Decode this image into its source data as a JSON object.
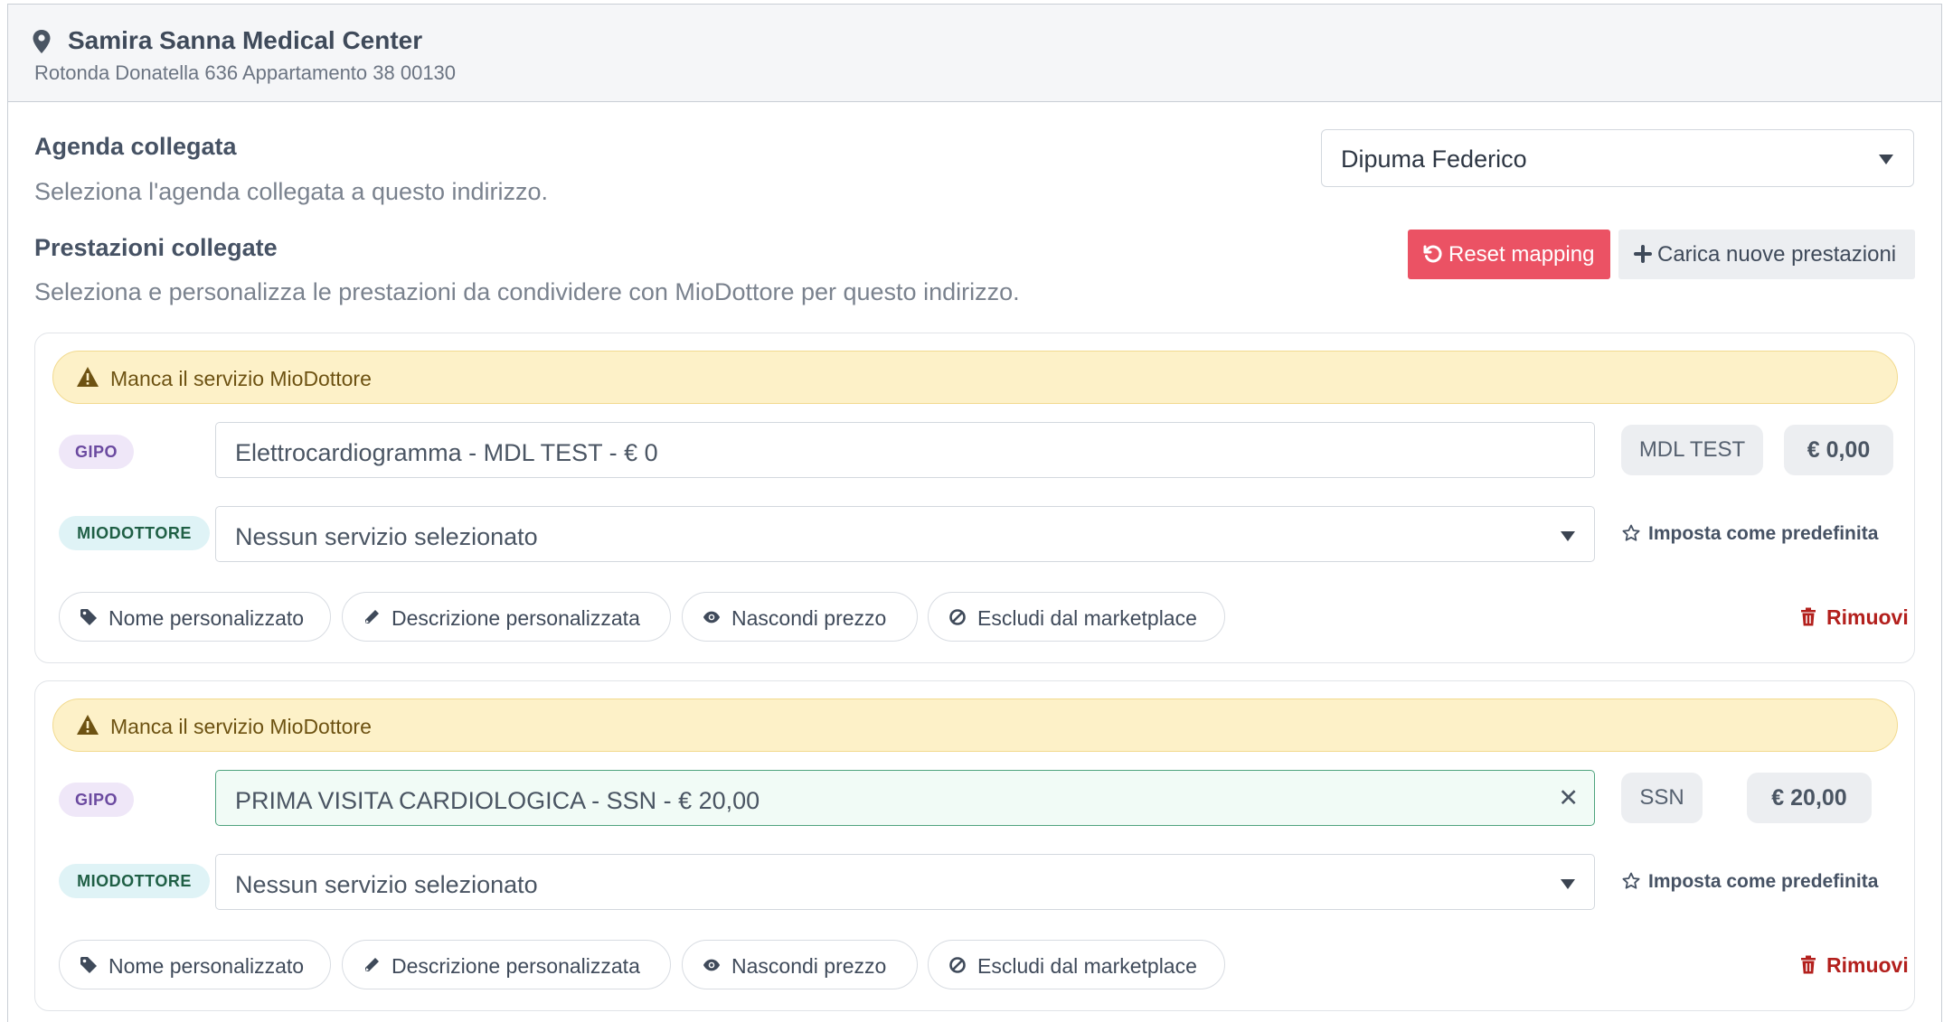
{
  "header": {
    "icon": "map-marker-icon",
    "title": "Samira Sanna Medical Center",
    "address": "Rotonda Donatella 636 Appartamento 38 00130"
  },
  "agenda": {
    "title": "Agenda collegata",
    "description": "Seleziona l'agenda collegata a questo indirizzo.",
    "selected": "Dipuma Federico"
  },
  "prestazioni": {
    "title": "Prestazioni collegate",
    "description": "Seleziona e personalizza le prestazioni da condividere con MioDottore per questo indirizzo.",
    "reset_label": "Reset mapping",
    "load_label": "Carica nuove prestazioni"
  },
  "colors": {
    "danger": "#eb5264",
    "warning_bg": "#fdf1c8",
    "active_border": "#4fa37e"
  },
  "cards": [
    {
      "alert": "Manca il servizio MioDottore",
      "gipo_badge": "GIPO",
      "gipo_value": "Elettrocardiogramma - MDL TEST - € 0",
      "tariff": "MDL TEST",
      "price": "€ 0,00",
      "miodottore_badge": "MIODOTTORE",
      "miodottore_value": "Nessun servizio selezionato",
      "default_label": "Imposta come predefinita",
      "chips": [
        "Nome personalizzato",
        "Descrizione personalizzata",
        "Nascondi prezzo",
        "Escludi dal marketplace"
      ],
      "remove_label": "Rimuovi"
    },
    {
      "alert": "Manca il servizio MioDottore",
      "gipo_badge": "GIPO",
      "gipo_value": "PRIMA VISITA CARDIOLOGICA - SSN - € 20,00",
      "clear_symbol": "✕",
      "tariff": "SSN",
      "price": "€ 20,00",
      "miodottore_badge": "MIODOTTORE",
      "miodottore_value": "Nessun servizio selezionato",
      "default_label": "Imposta come predefinita",
      "chips": [
        "Nome personalizzato",
        "Descrizione personalizzata",
        "Nascondi prezzo",
        "Escludi dal marketplace"
      ],
      "remove_label": "Rimuovi"
    }
  ]
}
